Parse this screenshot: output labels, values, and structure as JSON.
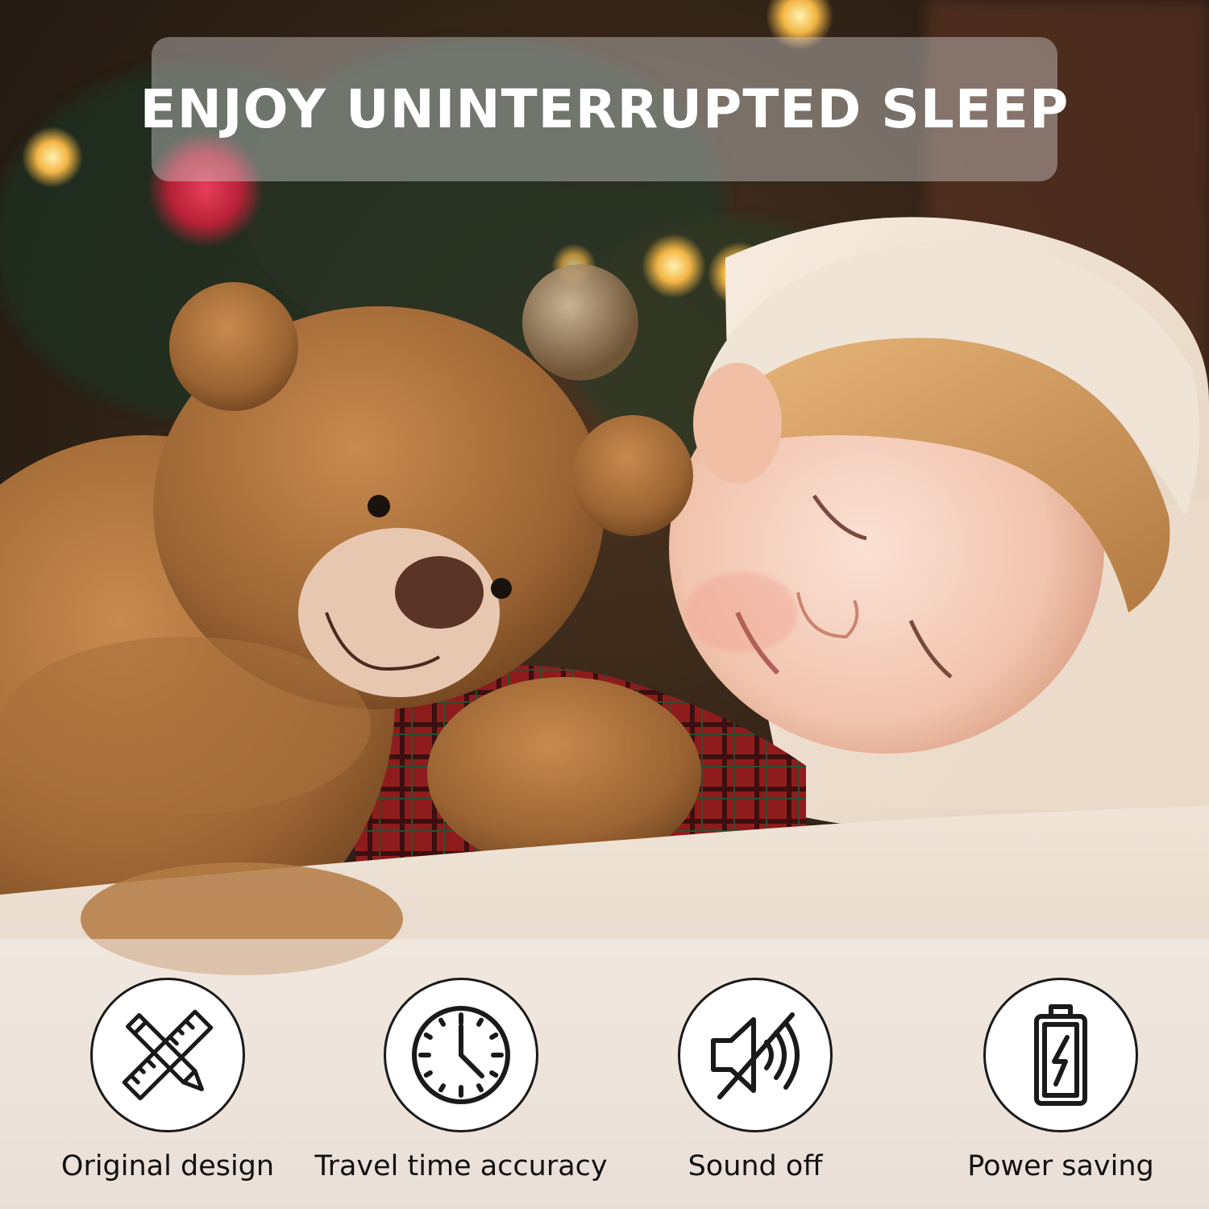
{
  "headline": "ENJOY UNINTERRUPTED SLEEP",
  "colors": {
    "headline_text": "#ffffff",
    "icon_stroke": "#1a1a1a",
    "label_text": "#111111"
  },
  "features": [
    {
      "icon": "ruler-pencil-icon",
      "label": "Original design"
    },
    {
      "icon": "clock-icon",
      "label": "Travel time accuracy"
    },
    {
      "icon": "speaker-muted-icon",
      "label": "Sound off"
    },
    {
      "icon": "battery-charging-icon",
      "label": "Power saving"
    }
  ]
}
